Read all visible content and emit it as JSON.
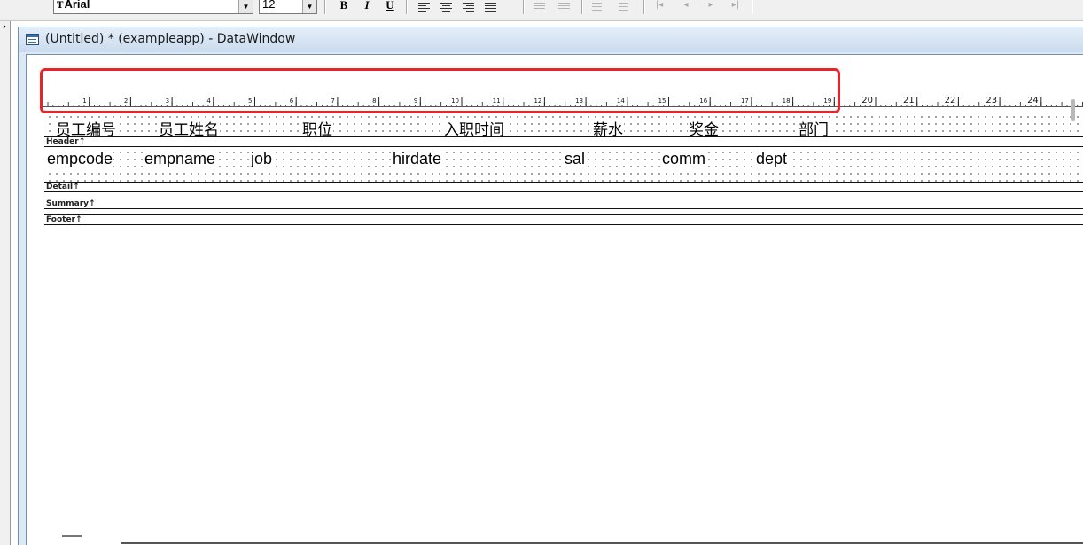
{
  "toolbar": {
    "font_name": "Arial",
    "font_size": "12",
    "bold_label": "B",
    "italic_label": "I",
    "underline_label": "U",
    "icons": [
      "align-left-icon",
      "align-center-icon",
      "align-right-icon",
      "justify-icon",
      "indent-icon",
      "outdent-icon",
      "list-icon",
      "list-x-icon",
      "first-icon",
      "prev-icon",
      "next-icon",
      "last-icon"
    ]
  },
  "window": {
    "title": "(Untitled) * (exampleapp) - DataWindow"
  },
  "ruler": {
    "labels": [
      "1",
      "2",
      "3",
      "4",
      "5",
      "6",
      "7",
      "8",
      "9",
      "10",
      "11",
      "12",
      "13",
      "14",
      "15",
      "16",
      "17",
      "18",
      "19",
      "20",
      "21",
      "22",
      "23",
      "24"
    ]
  },
  "header": {
    "band_label": "Header↑",
    "columns": [
      "员工编号",
      "员工姓名",
      "职位",
      "入职时间",
      "薪水",
      "奖金",
      "部门"
    ]
  },
  "detail": {
    "band_label": "Detail↑",
    "columns": [
      "empcode",
      "empname",
      "job",
      "hirdate",
      "sal",
      "comm",
      "dept"
    ]
  },
  "summary": {
    "band_label": "Summary↑"
  },
  "footer": {
    "band_label": "Footer↑"
  },
  "colors": {
    "highlight": "#e8242a",
    "title_bar": "#dce9f5"
  }
}
